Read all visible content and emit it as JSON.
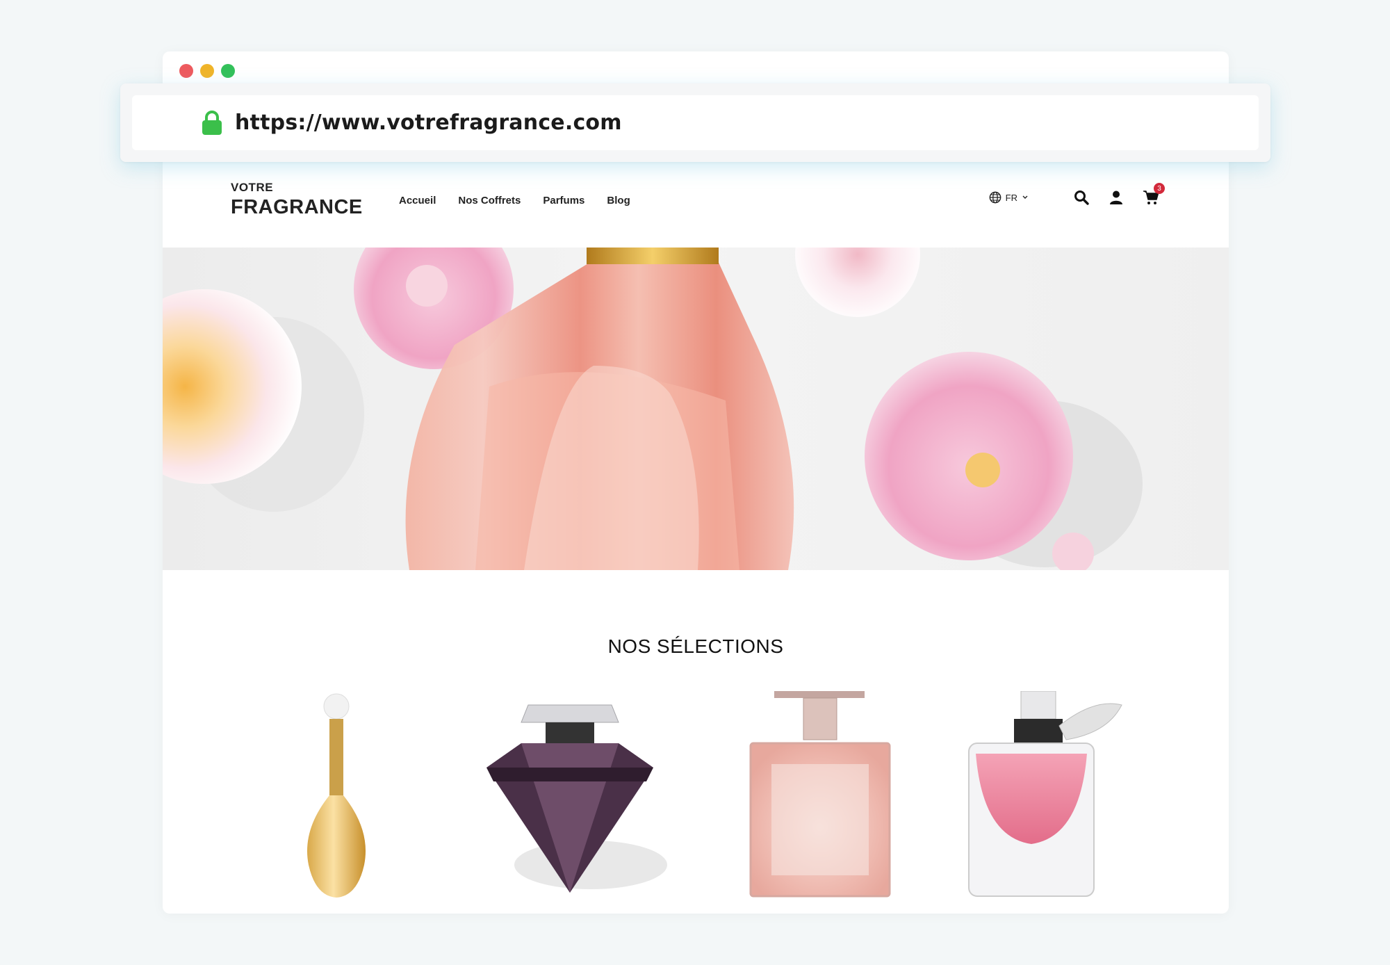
{
  "browser": {
    "url": "https://www.votrefragrance.com",
    "colors": {
      "close": "#ee5a5e",
      "minimize": "#f0b429",
      "maximize": "#33c15a",
      "lock": "#3bbf4a"
    }
  },
  "site": {
    "logo_top": "VOTRE",
    "logo_main": "FRAGRANCE",
    "nav": [
      "Accueil",
      "Nos Coffrets",
      "Parfums",
      "Blog"
    ],
    "language": "FR",
    "cart_count": "3",
    "icons": [
      "globe-icon",
      "chevron-down-icon",
      "search-icon",
      "user-icon",
      "cart-icon"
    ]
  },
  "hero": {
    "image": "pink-perfume-bottle-with-flowers"
  },
  "selections": {
    "title": "NOS SÉLECTIONS",
    "products": [
      "gold-teardrop-perfume",
      "purple-diamond-perfume",
      "pink-square-perfume",
      "pink-bow-perfume"
    ]
  }
}
